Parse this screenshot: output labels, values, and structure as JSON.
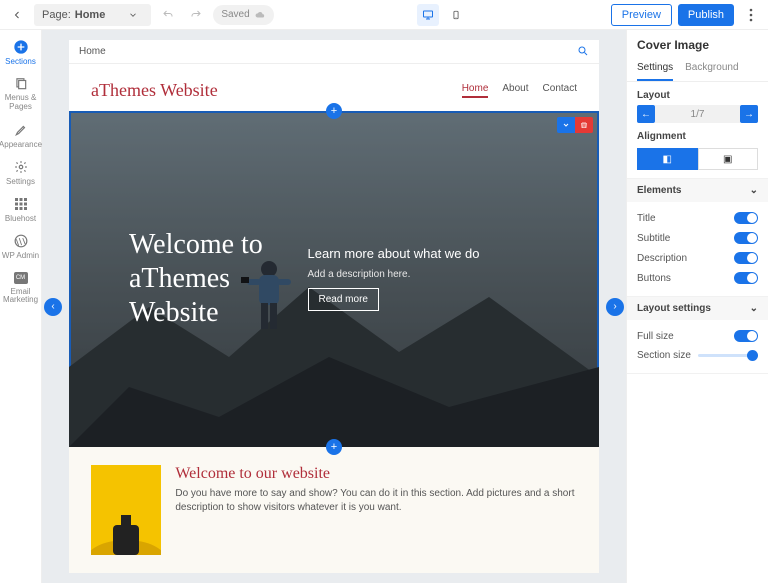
{
  "topbar": {
    "page_label": "Page:",
    "page_name": "Home",
    "saved_label": "Saved",
    "preview": "Preview",
    "publish": "Publish"
  },
  "leftrail": {
    "items": [
      {
        "label": "Sections"
      },
      {
        "label": "Menus & Pages"
      },
      {
        "label": "Appearance"
      },
      {
        "label": "Settings"
      },
      {
        "label": "Bluehost"
      },
      {
        "label": "WP Admin"
      },
      {
        "label": "Email Marketing"
      }
    ]
  },
  "stage": {
    "crumb": "Home",
    "brand": "aThemes Website",
    "nav": [
      "Home",
      "About",
      "Contact"
    ],
    "hero": {
      "title": "Welcome to aThemes Website",
      "subtitle": "Learn more about what we do",
      "desc": "Add a description here.",
      "button": "Read more"
    },
    "below": {
      "heading": "Welcome to our website",
      "body": "Do you have more to say and show? You can do it in this section. Add pictures and a short description to show visitors whatever it is you want."
    }
  },
  "panel": {
    "title": "Cover Image",
    "tabs": [
      "Settings",
      "Background"
    ],
    "layout_label": "Layout",
    "page_indicator": "1/7",
    "alignment_label": "Alignment",
    "elements_label": "Elements",
    "elements": [
      {
        "label": "Title"
      },
      {
        "label": "Subtitle"
      },
      {
        "label": "Description"
      },
      {
        "label": "Buttons"
      }
    ],
    "layout_settings_label": "Layout settings",
    "full_size_label": "Full size",
    "section_size_label": "Section size"
  }
}
